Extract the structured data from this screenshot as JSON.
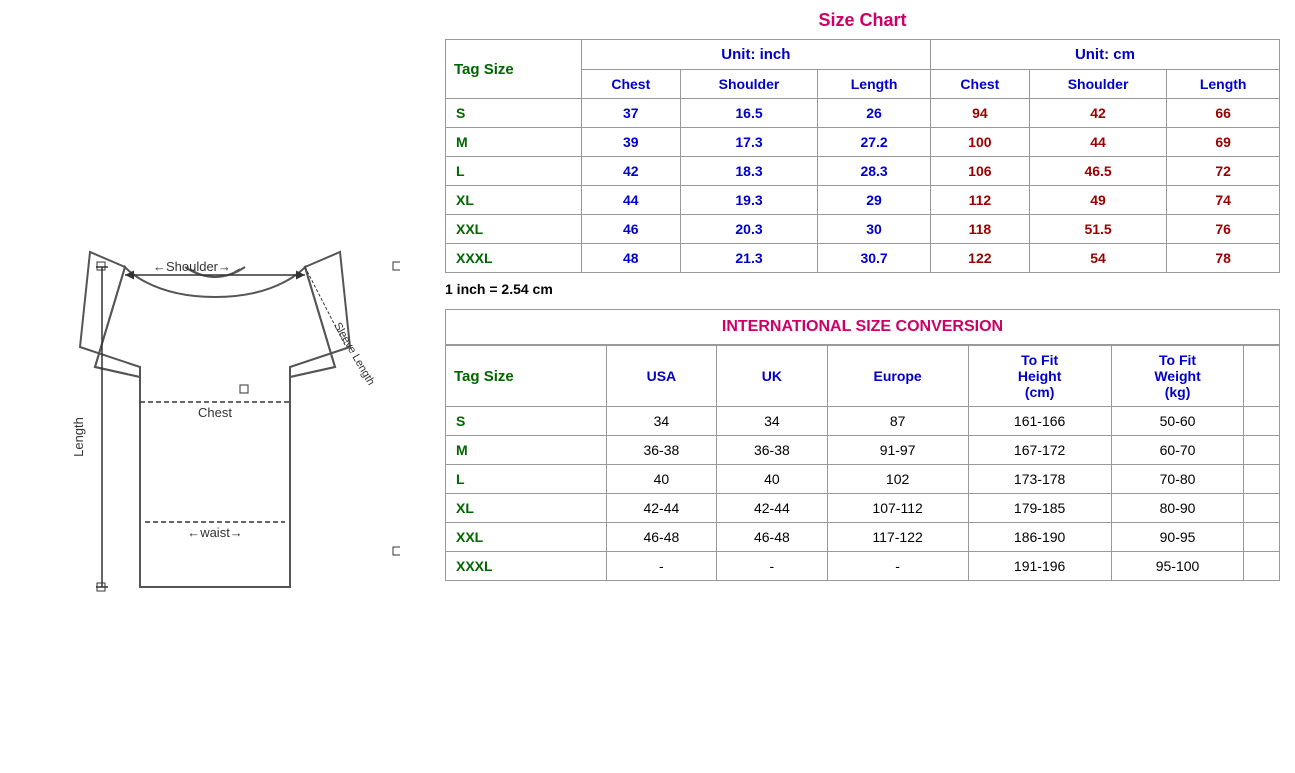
{
  "page": {
    "title": "Size Chart",
    "conversion_note": "1 inch = 2.54 cm",
    "unit_inch": "Unit: inch",
    "unit_cm": "Unit: cm",
    "intl_title": "INTERNATIONAL SIZE CONVERSION"
  },
  "size_table": {
    "tag_size_label": "Tag Size",
    "inch_headers": [
      "Chest",
      "Shoulder",
      "Length"
    ],
    "cm_headers": [
      "Chest",
      "Shoulder",
      "Length"
    ],
    "rows": [
      {
        "tag": "S",
        "inch_chest": "37",
        "inch_shoulder": "16.5",
        "inch_length": "26",
        "cm_chest": "94",
        "cm_shoulder": "42",
        "cm_length": "66"
      },
      {
        "tag": "M",
        "inch_chest": "39",
        "inch_shoulder": "17.3",
        "inch_length": "27.2",
        "cm_chest": "100",
        "cm_shoulder": "44",
        "cm_length": "69"
      },
      {
        "tag": "L",
        "inch_chest": "42",
        "inch_shoulder": "18.3",
        "inch_length": "28.3",
        "cm_chest": "106",
        "cm_shoulder": "46.5",
        "cm_length": "72"
      },
      {
        "tag": "XL",
        "inch_chest": "44",
        "inch_shoulder": "19.3",
        "inch_length": "29",
        "cm_chest": "112",
        "cm_shoulder": "49",
        "cm_length": "74"
      },
      {
        "tag": "XXL",
        "inch_chest": "46",
        "inch_shoulder": "20.3",
        "inch_length": "30",
        "cm_chest": "118",
        "cm_shoulder": "51.5",
        "cm_length": "76"
      },
      {
        "tag": "XXXL",
        "inch_chest": "48",
        "inch_shoulder": "21.3",
        "inch_length": "30.7",
        "cm_chest": "122",
        "cm_shoulder": "54",
        "cm_length": "78"
      }
    ]
  },
  "intl_table": {
    "tag_size_label": "Tag Size",
    "headers": [
      "USA",
      "UK",
      "Europe",
      "To Fit Height (cm)",
      "To Fit Weight (kg)"
    ],
    "rows": [
      {
        "tag": "S",
        "usa": "34",
        "uk": "34",
        "europe": "87",
        "height": "161-166",
        "weight": "50-60"
      },
      {
        "tag": "M",
        "usa": "36-38",
        "uk": "36-38",
        "europe": "91-97",
        "height": "167-172",
        "weight": "60-70"
      },
      {
        "tag": "L",
        "usa": "40",
        "uk": "40",
        "europe": "102",
        "height": "173-178",
        "weight": "70-80"
      },
      {
        "tag": "XL",
        "usa": "42-44",
        "uk": "42-44",
        "europe": "107-112",
        "height": "179-185",
        "weight": "80-90"
      },
      {
        "tag": "XXL",
        "usa": "46-48",
        "uk": "46-48",
        "europe": "117-122",
        "height": "186-190",
        "weight": "90-95"
      },
      {
        "tag": "XXXL",
        "usa": "-",
        "uk": "-",
        "europe": "-",
        "height": "191-196",
        "weight": "95-100"
      }
    ]
  },
  "diagram": {
    "shoulder_label": "Shoulder",
    "sleeve_label": "Sleeve Length",
    "chest_label": "Chest",
    "length_label": "Length",
    "waist_label": "waist"
  }
}
